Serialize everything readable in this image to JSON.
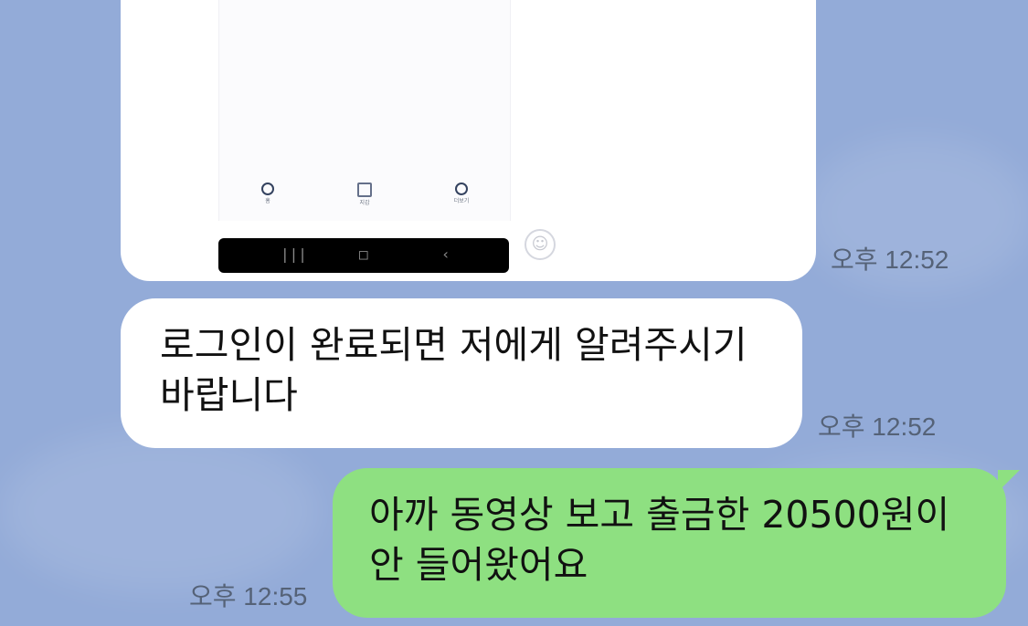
{
  "messages": [
    {
      "type": "image",
      "direction": "received",
      "time": "오후 12:52",
      "screenshot_nav": [
        "홈",
        "지갑",
        "더보기"
      ]
    },
    {
      "type": "text",
      "direction": "received",
      "text": "로그인이 완료되면 저에게 알려주시기 바랍니다",
      "time": "오후 12:52"
    },
    {
      "type": "text",
      "direction": "sent",
      "text": "아까 동영상 보고 출금한 20500원이 안 들어왔어요",
      "time": "오후 12:55"
    }
  ],
  "icons": {
    "emoji": "smiley-icon",
    "recents": "recents-icon",
    "home": "home-icon",
    "back": "back-icon"
  },
  "colors": {
    "chat_background": "#93abd8",
    "received_bubble": "#ffffff",
    "sent_bubble": "#8ee081",
    "timestamp": "#556277",
    "text": "#111111"
  }
}
